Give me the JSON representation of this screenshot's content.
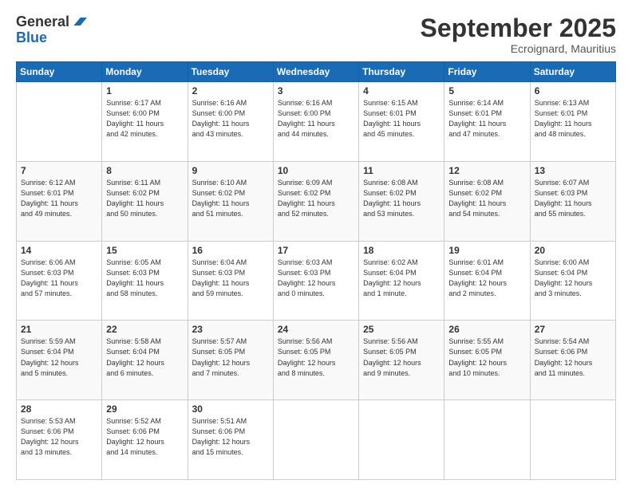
{
  "header": {
    "logo_line1": "General",
    "logo_line2": "Blue",
    "month": "September 2025",
    "location": "Ecroignard, Mauritius"
  },
  "weekdays": [
    "Sunday",
    "Monday",
    "Tuesday",
    "Wednesday",
    "Thursday",
    "Friday",
    "Saturday"
  ],
  "weeks": [
    [
      {
        "day": "",
        "info": ""
      },
      {
        "day": "1",
        "info": "Sunrise: 6:17 AM\nSunset: 6:00 PM\nDaylight: 11 hours\nand 42 minutes."
      },
      {
        "day": "2",
        "info": "Sunrise: 6:16 AM\nSunset: 6:00 PM\nDaylight: 11 hours\nand 43 minutes."
      },
      {
        "day": "3",
        "info": "Sunrise: 6:16 AM\nSunset: 6:00 PM\nDaylight: 11 hours\nand 44 minutes."
      },
      {
        "day": "4",
        "info": "Sunrise: 6:15 AM\nSunset: 6:01 PM\nDaylight: 11 hours\nand 45 minutes."
      },
      {
        "day": "5",
        "info": "Sunrise: 6:14 AM\nSunset: 6:01 PM\nDaylight: 11 hours\nand 47 minutes."
      },
      {
        "day": "6",
        "info": "Sunrise: 6:13 AM\nSunset: 6:01 PM\nDaylight: 11 hours\nand 48 minutes."
      }
    ],
    [
      {
        "day": "7",
        "info": "Sunrise: 6:12 AM\nSunset: 6:01 PM\nDaylight: 11 hours\nand 49 minutes."
      },
      {
        "day": "8",
        "info": "Sunrise: 6:11 AM\nSunset: 6:02 PM\nDaylight: 11 hours\nand 50 minutes."
      },
      {
        "day": "9",
        "info": "Sunrise: 6:10 AM\nSunset: 6:02 PM\nDaylight: 11 hours\nand 51 minutes."
      },
      {
        "day": "10",
        "info": "Sunrise: 6:09 AM\nSunset: 6:02 PM\nDaylight: 11 hours\nand 52 minutes."
      },
      {
        "day": "11",
        "info": "Sunrise: 6:08 AM\nSunset: 6:02 PM\nDaylight: 11 hours\nand 53 minutes."
      },
      {
        "day": "12",
        "info": "Sunrise: 6:08 AM\nSunset: 6:02 PM\nDaylight: 11 hours\nand 54 minutes."
      },
      {
        "day": "13",
        "info": "Sunrise: 6:07 AM\nSunset: 6:03 PM\nDaylight: 11 hours\nand 55 minutes."
      }
    ],
    [
      {
        "day": "14",
        "info": "Sunrise: 6:06 AM\nSunset: 6:03 PM\nDaylight: 11 hours\nand 57 minutes."
      },
      {
        "day": "15",
        "info": "Sunrise: 6:05 AM\nSunset: 6:03 PM\nDaylight: 11 hours\nand 58 minutes."
      },
      {
        "day": "16",
        "info": "Sunrise: 6:04 AM\nSunset: 6:03 PM\nDaylight: 11 hours\nand 59 minutes."
      },
      {
        "day": "17",
        "info": "Sunrise: 6:03 AM\nSunset: 6:03 PM\nDaylight: 12 hours\nand 0 minutes."
      },
      {
        "day": "18",
        "info": "Sunrise: 6:02 AM\nSunset: 6:04 PM\nDaylight: 12 hours\nand 1 minute."
      },
      {
        "day": "19",
        "info": "Sunrise: 6:01 AM\nSunset: 6:04 PM\nDaylight: 12 hours\nand 2 minutes."
      },
      {
        "day": "20",
        "info": "Sunrise: 6:00 AM\nSunset: 6:04 PM\nDaylight: 12 hours\nand 3 minutes."
      }
    ],
    [
      {
        "day": "21",
        "info": "Sunrise: 5:59 AM\nSunset: 6:04 PM\nDaylight: 12 hours\nand 5 minutes."
      },
      {
        "day": "22",
        "info": "Sunrise: 5:58 AM\nSunset: 6:04 PM\nDaylight: 12 hours\nand 6 minutes."
      },
      {
        "day": "23",
        "info": "Sunrise: 5:57 AM\nSunset: 6:05 PM\nDaylight: 12 hours\nand 7 minutes."
      },
      {
        "day": "24",
        "info": "Sunrise: 5:56 AM\nSunset: 6:05 PM\nDaylight: 12 hours\nand 8 minutes."
      },
      {
        "day": "25",
        "info": "Sunrise: 5:56 AM\nSunset: 6:05 PM\nDaylight: 12 hours\nand 9 minutes."
      },
      {
        "day": "26",
        "info": "Sunrise: 5:55 AM\nSunset: 6:05 PM\nDaylight: 12 hours\nand 10 minutes."
      },
      {
        "day": "27",
        "info": "Sunrise: 5:54 AM\nSunset: 6:06 PM\nDaylight: 12 hours\nand 11 minutes."
      }
    ],
    [
      {
        "day": "28",
        "info": "Sunrise: 5:53 AM\nSunset: 6:06 PM\nDaylight: 12 hours\nand 13 minutes."
      },
      {
        "day": "29",
        "info": "Sunrise: 5:52 AM\nSunset: 6:06 PM\nDaylight: 12 hours\nand 14 minutes."
      },
      {
        "day": "30",
        "info": "Sunrise: 5:51 AM\nSunset: 6:06 PM\nDaylight: 12 hours\nand 15 minutes."
      },
      {
        "day": "",
        "info": ""
      },
      {
        "day": "",
        "info": ""
      },
      {
        "day": "",
        "info": ""
      },
      {
        "day": "",
        "info": ""
      }
    ]
  ]
}
